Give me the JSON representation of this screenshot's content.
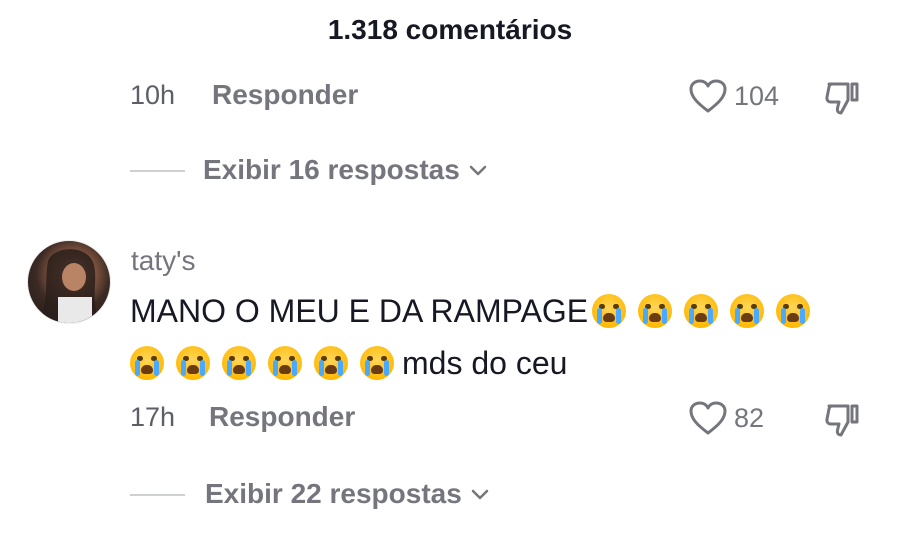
{
  "header": {
    "title": "1.318 comentários"
  },
  "comment1": {
    "time": "10h",
    "reply_label": "Responder",
    "like_count": "104",
    "view_replies": "Exibir 16 respostas"
  },
  "comment2": {
    "username": "taty's",
    "text_line1": "MANO O MEU E DA RAMPAGE",
    "text_line2_suffix": "mds do ceu",
    "emoji_name": "loudly-crying-face",
    "emoji_count_line1": 5,
    "emoji_count_line2": 6,
    "time": "17h",
    "reply_label": "Responder",
    "like_count": "82",
    "view_replies": "Exibir 22 respostas"
  },
  "icons": {
    "like": "heart-icon",
    "dislike": "thumbs-down-icon",
    "expand": "chevron-down-icon"
  },
  "colors": {
    "text": "#161823",
    "muted": "#75767d",
    "emoji": "#ffb800"
  }
}
